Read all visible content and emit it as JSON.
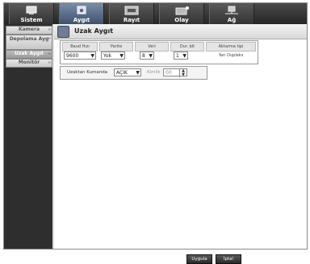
{
  "tabs": [
    {
      "label": "Sistem",
      "icon": "system-icon",
      "active": false
    },
    {
      "label": "Aygıt",
      "icon": "device-icon",
      "active": true
    },
    {
      "label": "Rayıt",
      "icon": "record-icon",
      "active": false
    },
    {
      "label": "Olay",
      "icon": "event-icon",
      "active": false
    },
    {
      "label": "Ağ",
      "icon": "network-icon",
      "active": false
    }
  ],
  "sidebar": {
    "items": [
      {
        "label": "Kamera"
      },
      {
        "label": "Depolama Ayg"
      },
      {
        "label": "Uzak Aygıt"
      },
      {
        "label": "Monitör"
      }
    ]
  },
  "page": {
    "title": "Uzak Aygıt"
  },
  "table": {
    "headers": [
      "Baud Hızı",
      "Parite",
      "Veri",
      "Dur. bit",
      "Aktarma tipi"
    ],
    "values": {
      "baud": "9600",
      "parity": "Yok",
      "data": "8",
      "stop": "1",
      "transfer": "Yarı Dupleks"
    }
  },
  "remote": {
    "label": "Uzaktan Kumanda",
    "value": "AÇIK",
    "id_label": "Kimlik",
    "id_value": "00"
  },
  "buttons": {
    "apply": "Uygula",
    "cancel": "İptal"
  },
  "colors": {
    "active_tab": "#3e526e",
    "sidebar_bg": "#2e2e2e",
    "button_bg": "#2a2a2a"
  }
}
